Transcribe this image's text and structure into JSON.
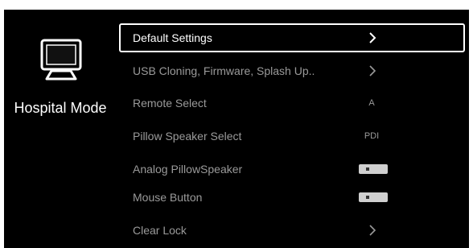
{
  "side_panel": {
    "icon": "monitor-icon",
    "title": "Hospital Mode"
  },
  "menu": {
    "items": [
      {
        "label": "Default Settings",
        "control": "chevron",
        "selected": true
      },
      {
        "label": "USB Cloning, Firmware, Splash Up..",
        "control": "chevron",
        "selected": false
      },
      {
        "label": "Remote Select",
        "control": "value",
        "value": "A",
        "selected": false
      },
      {
        "label": "Pillow Speaker Select",
        "control": "value",
        "value": "PDI",
        "selected": false
      },
      {
        "label": "Analog PillowSpeaker",
        "control": "toggle",
        "state": "off",
        "selected": false
      },
      {
        "label": "Mouse Button",
        "control": "toggle",
        "state": "off",
        "selected": false
      },
      {
        "label": "Clear Lock",
        "control": "chevron",
        "selected": false
      }
    ]
  },
  "colors": {
    "background": "#000000",
    "selected_text": "#ffffff",
    "item_text": "#9a9a9a",
    "toggle": "#cfcfcf"
  }
}
